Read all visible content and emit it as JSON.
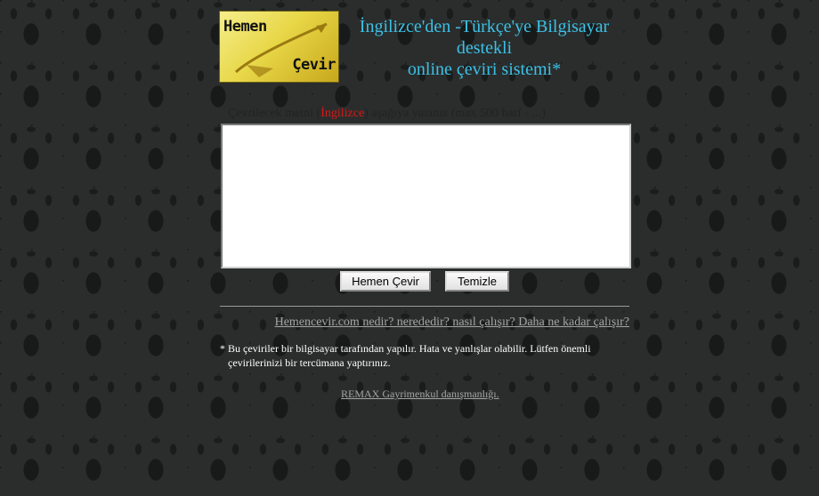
{
  "logo": {
    "line1": "Hemen",
    "line2": "Çevir"
  },
  "headline": {
    "line1": "İngilizce'den -Türkçe'ye Bilgisayar",
    "line2": "destekli",
    "line3": "online çeviri sistemi*"
  },
  "instruction": {
    "prefix": "Çevrilecek metni (",
    "language": "İngilizce",
    "suffix": ") aşağıya yazınız (max 500 harf - ...)"
  },
  "source_text": {
    "value": ""
  },
  "buttons": {
    "translate": "Hemen Çevir",
    "clear": "Temizle"
  },
  "faq_link": "Hemencevir.com nedir? nerededir? nasıl çalışır? Daha ne kadar çalışır?",
  "disclaimer": {
    "line1": "* Bu çeviriler bir bilgisayar tarafından yapılır. Hata ve yanlışlar olabilir. Lütfen önemli",
    "line2": "çevirilerinizi bir tercümana yaptırınız."
  },
  "remax_link": "REMAX Gayrimenkul danışmanlığı.",
  "colors": {
    "headline": "#3cc0e6",
    "language_highlight": "#d81818",
    "link": "#a4a4a4",
    "background": "#2a2d2c"
  }
}
